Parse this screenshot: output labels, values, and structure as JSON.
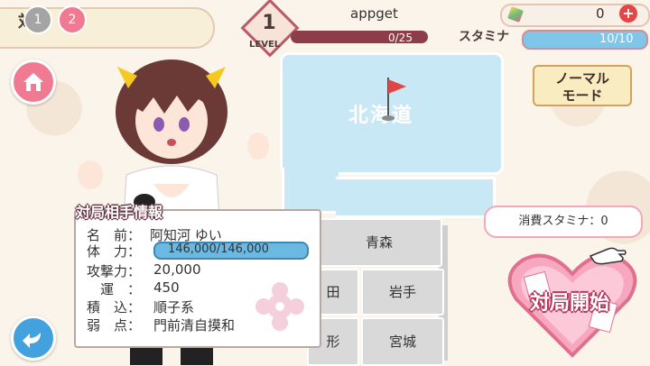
{
  "header": {
    "title": "対局",
    "badges": [
      "1",
      "2"
    ],
    "level_value": "1",
    "level_label": "LEVEL",
    "username": "appget",
    "xp_text": "0/25",
    "stamina_label": "スタミナ",
    "stamina_text": "10/10",
    "coins": "0"
  },
  "map": {
    "region_label": "北海道",
    "prefectures": [
      "青森",
      "田",
      "岩手",
      "形",
      "宮城"
    ]
  },
  "opponent": {
    "panel_title": "対局相手情報",
    "rows": [
      {
        "label": "名　前：",
        "value": "阿知河 ゆい"
      },
      {
        "label": "体　力：",
        "value": "146,000/146,000"
      },
      {
        "label": "攻撃力：",
        "value": "20,000"
      },
      {
        "label": "　運　：",
        "value": "450"
      },
      {
        "label": "積　込：",
        "value": "順子系"
      },
      {
        "label": "弱　点：",
        "value": "門前清自摸和"
      }
    ]
  },
  "mode_button": {
    "line1": "ノーマル",
    "line2": "モード"
  },
  "stamina_cost": "消費スタミナ：0",
  "start_button": "対局開始",
  "colors": {
    "accent_pink": "#f07a92",
    "stamina_blue": "#7fc6e8",
    "back_blue": "#43a2de"
  }
}
